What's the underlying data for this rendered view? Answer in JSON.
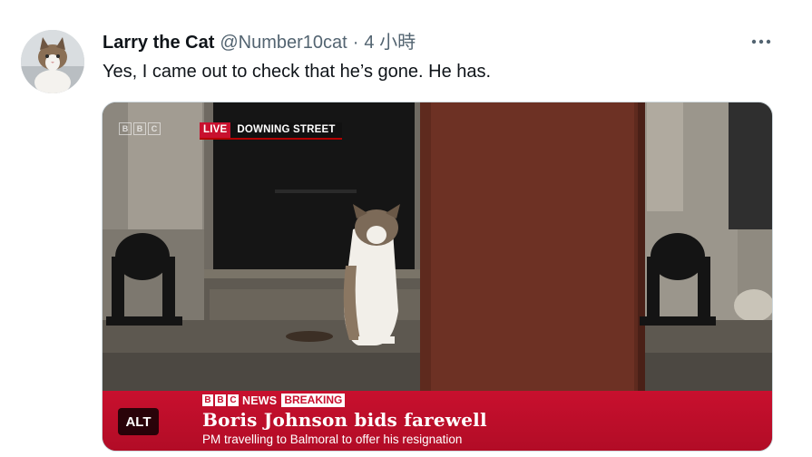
{
  "tweet": {
    "author": {
      "display_name": "Larry the Cat",
      "handle": "@Number10cat",
      "avatar_icon": "cat-avatar"
    },
    "separator": "·",
    "timestamp": "4 小時",
    "text": "Yes, I came out to check that he’s gone. He has.",
    "more_icon": "more-dots-icon"
  },
  "media": {
    "watermark": [
      "B",
      "B",
      "C"
    ],
    "live_tag": {
      "live": "LIVE",
      "location": "DOWNING STREET"
    },
    "news_bar": {
      "logo_letters": [
        "B",
        "B",
        "C"
      ],
      "brand": "NEWS",
      "breaking": "BREAKING",
      "headline": "Boris Johnson bids farewell",
      "subline": "PM travelling to Balmoral to offer his resignation"
    },
    "alt_badge": "ALT"
  },
  "colors": {
    "bbc_red": "#c8102e",
    "secondary_text": "#536471",
    "primary_text": "#0f1419"
  }
}
